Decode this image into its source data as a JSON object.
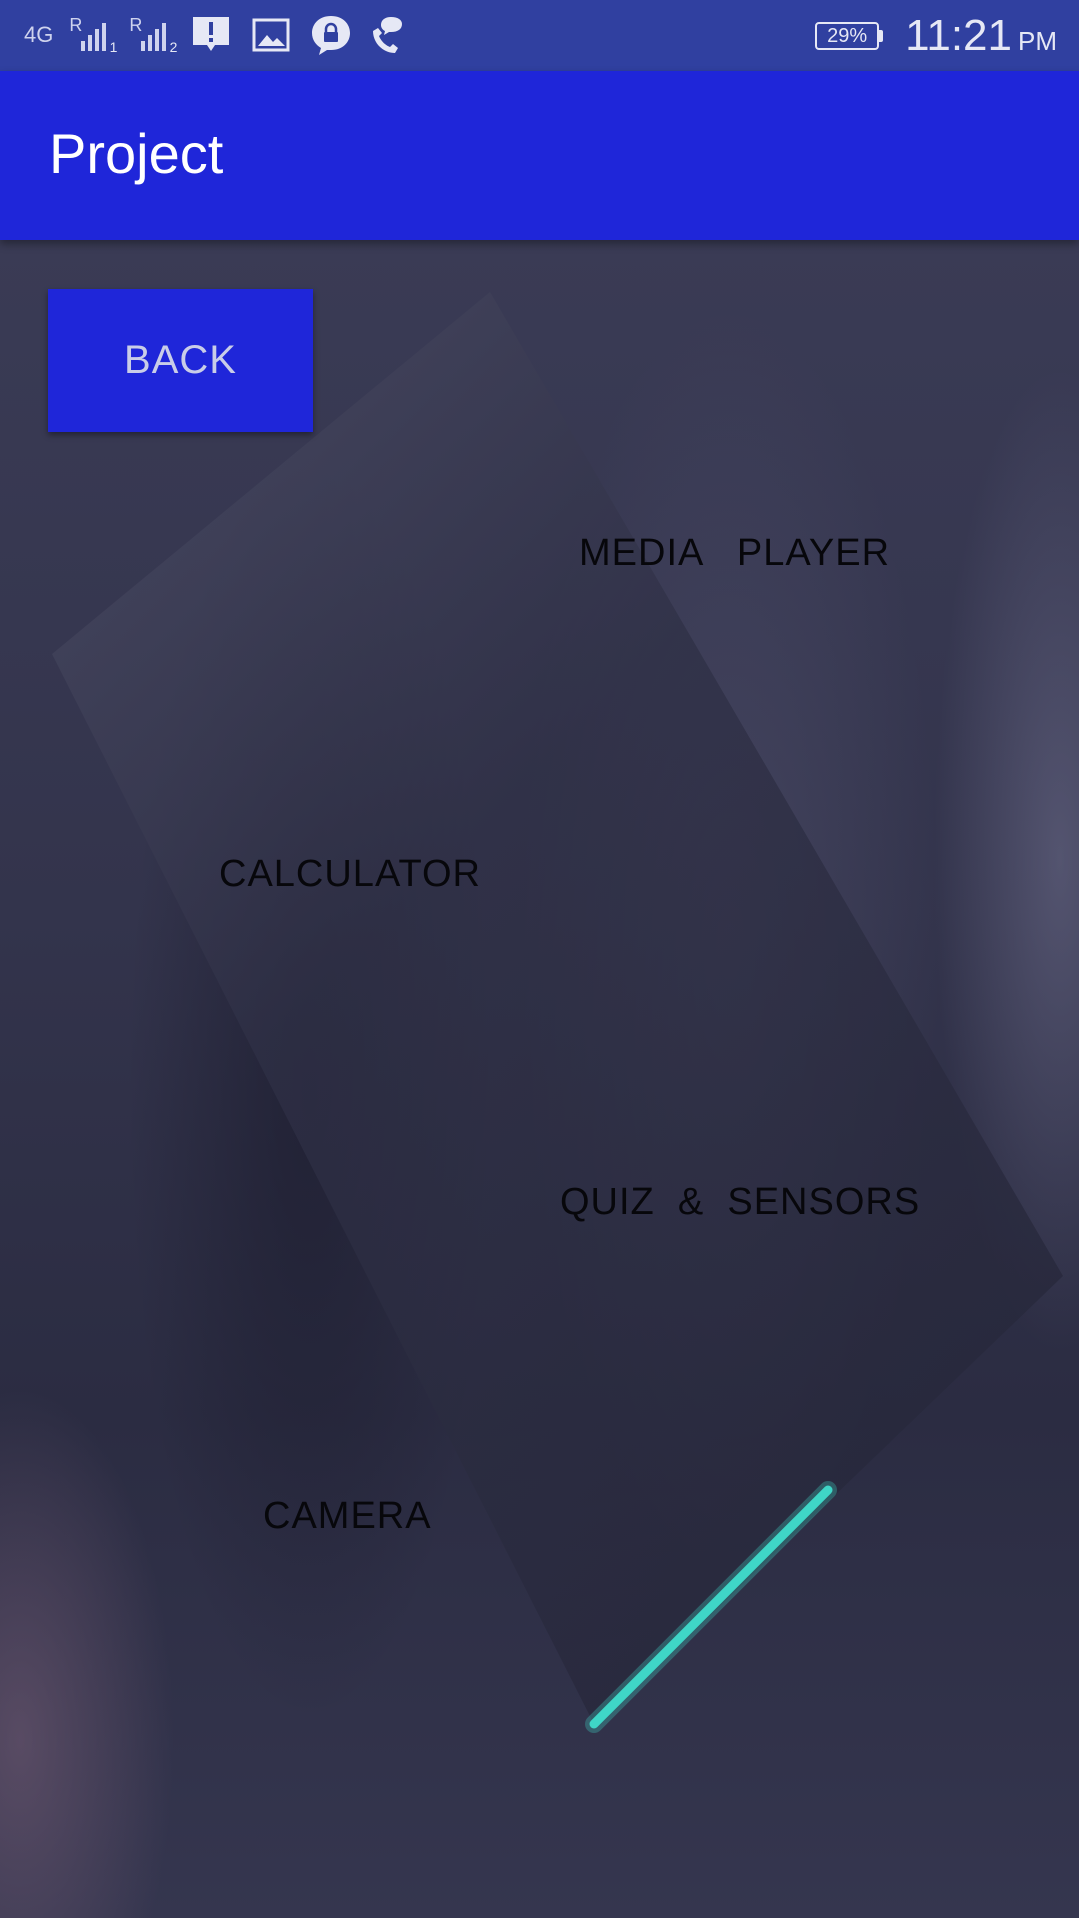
{
  "status_bar": {
    "network_label": "4G",
    "sim1_label": "R",
    "sim1_index": "1",
    "sim2_label": "R",
    "sim2_index": "2",
    "battery": "29%",
    "time": "11:21",
    "ampm": "PM",
    "icons": [
      "alert-icon",
      "image-icon",
      "lock-chat-icon",
      "call-chat-icon"
    ]
  },
  "app_bar": {
    "title": "Project"
  },
  "actions": {
    "back_label": "BACK"
  },
  "menu": {
    "items": [
      {
        "id": "media-player",
        "label": "MEDIA   PLAYER"
      },
      {
        "id": "calculator",
        "label": "CALCULATOR"
      },
      {
        "id": "quiz-sensors",
        "label": "QUIZ  &  SENSORS"
      },
      {
        "id": "camera",
        "label": "CAMERA"
      }
    ]
  },
  "colors": {
    "status_bar": "#3040a0",
    "app_bar": "#1f26d9",
    "button": "#1f26d9",
    "accent_line": "#3fd6c8",
    "label_text": "#07070b"
  }
}
